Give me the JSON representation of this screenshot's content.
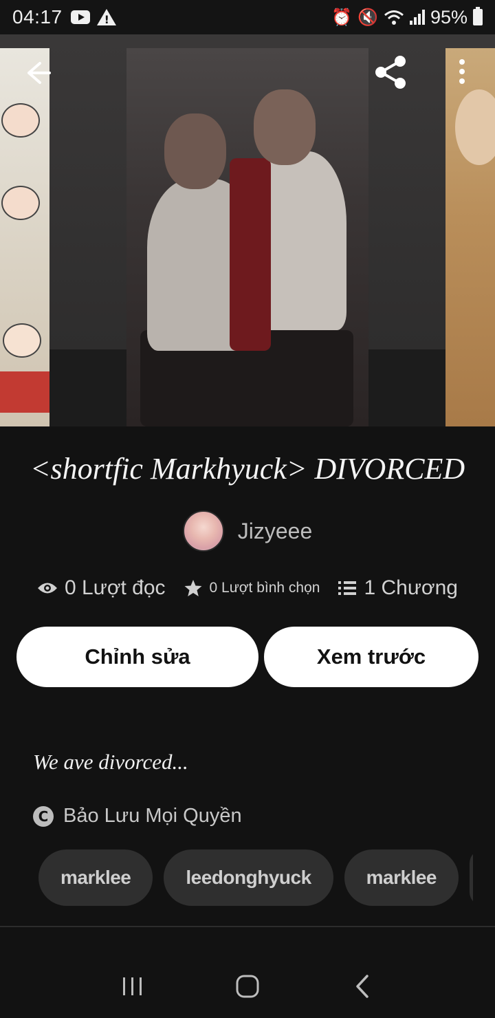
{
  "status_bar": {
    "time": "04:17",
    "battery": "95%"
  },
  "story": {
    "title": "<shortfic Markhyuck> DIVORCED",
    "author": "Jizyeee",
    "stats": {
      "reads": "0 Lượt đọc",
      "votes": "0 Lượt bình chọn",
      "chapters": "1 Chương"
    },
    "description": "We ave divorced...",
    "copyright": "Bảo Lưu Mọi Quyền",
    "tags": [
      "marklee",
      "leedonghyuck",
      "marklee"
    ]
  },
  "actions": {
    "edit_label": "Chỉnh sửa",
    "preview_label": "Xem trước"
  },
  "icons": {
    "back": "arrow-left-icon",
    "share": "share-icon",
    "more": "more-vertical-icon",
    "reads": "eye-icon",
    "votes": "star-icon",
    "chapters": "list-icon",
    "copyright": "copyright-icon"
  }
}
